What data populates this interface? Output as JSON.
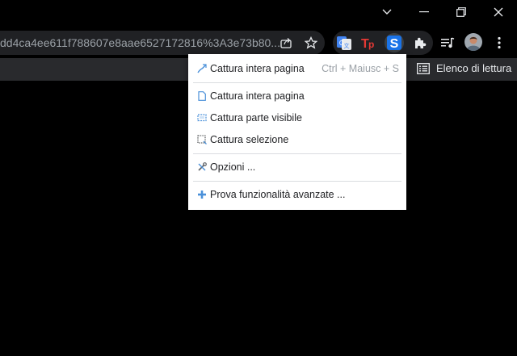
{
  "window": {
    "minimize_icon": "chevron-down-icon",
    "restore_icon": "restore-icon",
    "close_icon": "close-icon"
  },
  "omnibox": {
    "url_text": "dd4ca4ee611f788607e8aae6527172816%3A3e73b80..."
  },
  "bookmarks_bar": {
    "reading_list_label": "Elenco di lettura"
  },
  "menu": {
    "items": [
      {
        "label": "Cattura intera pagina",
        "shortcut": "Ctrl + Maiusc + S",
        "icon": "fullpage-capture-icon"
      },
      {
        "label": "Cattura intera pagina",
        "icon": "page-icon"
      },
      {
        "label": "Cattura parte visibile",
        "icon": "visible-part-icon"
      },
      {
        "label": "Cattura selezione",
        "icon": "selection-icon"
      },
      {
        "label": "Opzioni ...",
        "icon": "tools-icon"
      },
      {
        "label": "Prova funzionalità avanzate ...",
        "icon": "plus-icon"
      }
    ]
  },
  "colors": {
    "chrome_bg": "#000000",
    "omnibox_bg": "#202124",
    "bookmarks_bg": "#292a2d",
    "accent_blue": "#4a90d9",
    "tp_red": "#e53935"
  }
}
